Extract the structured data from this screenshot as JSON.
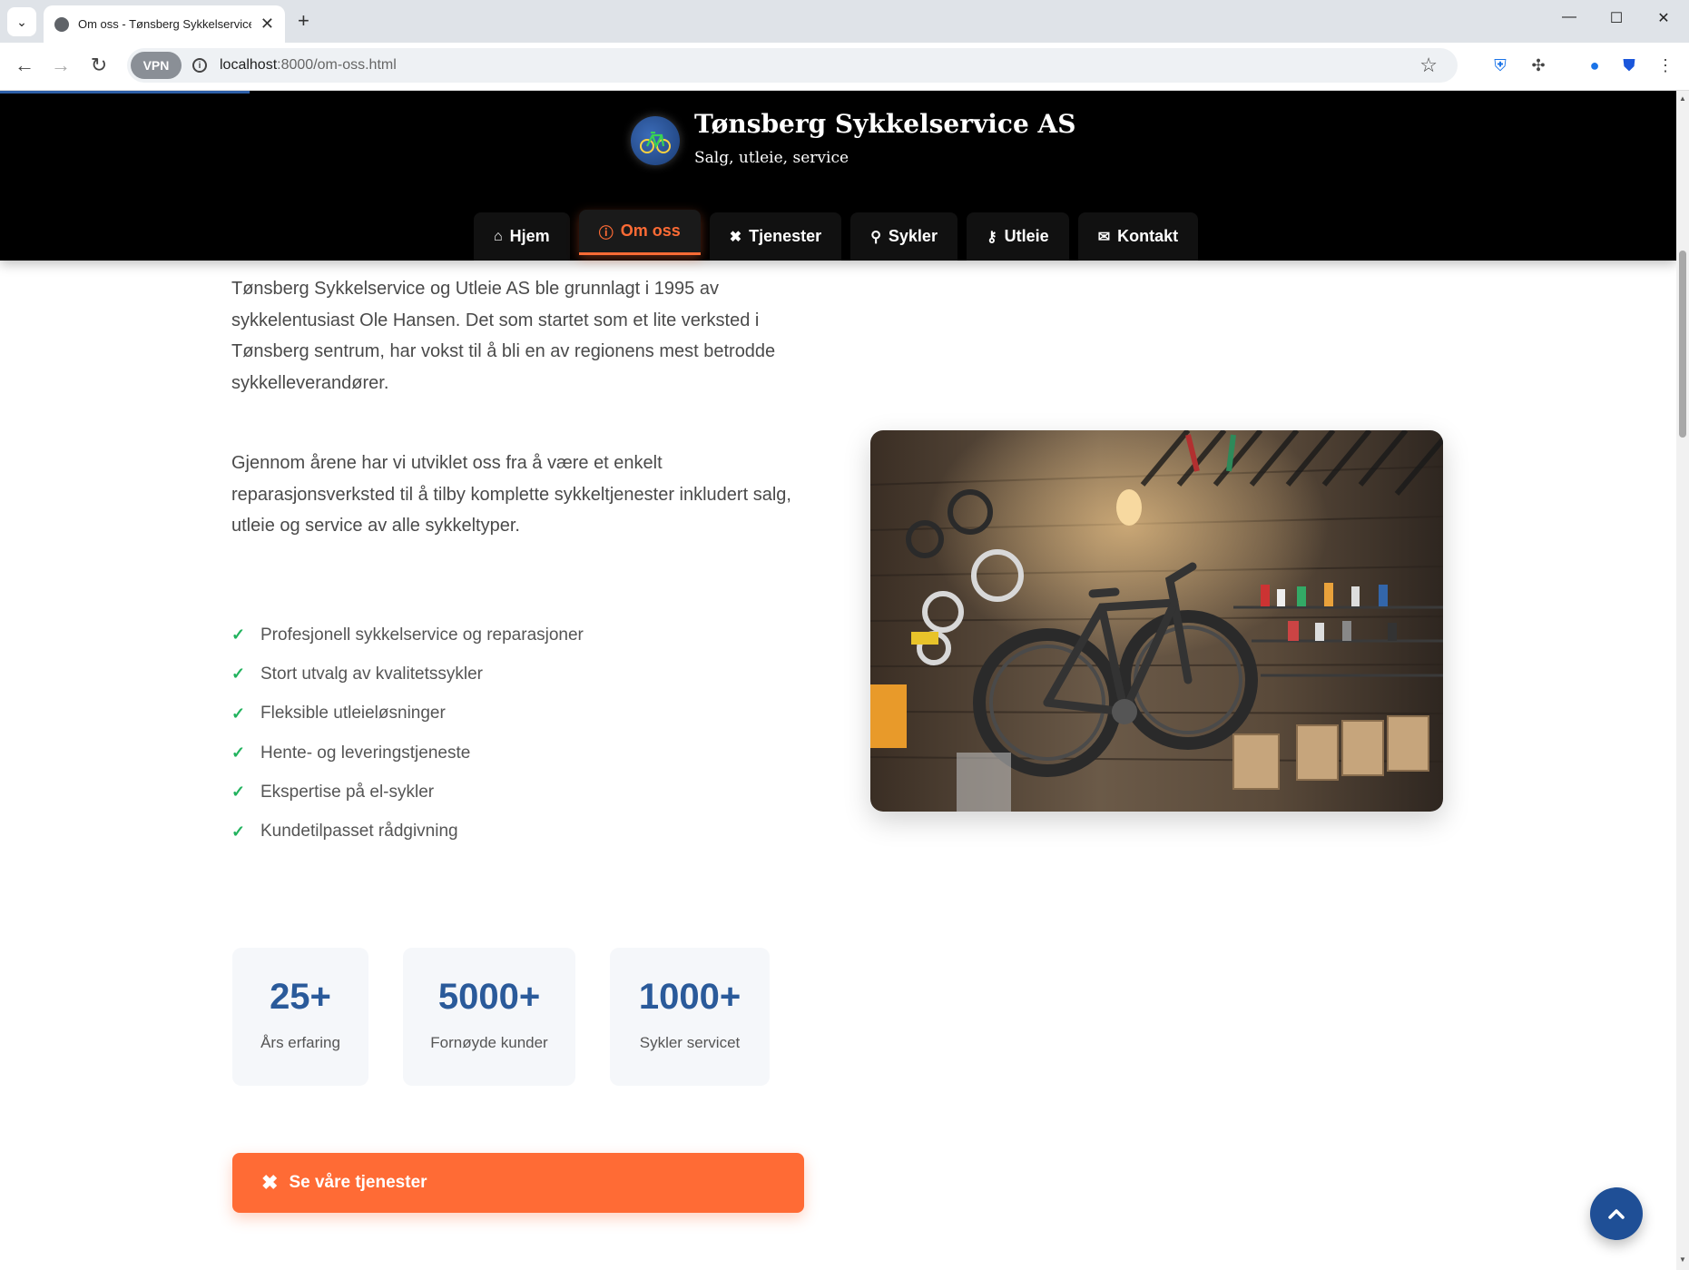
{
  "browser": {
    "tab_title": "Om oss - Tønsberg Sykkelservice o",
    "url_host": "localhost",
    "url_rest": ":8000/om-oss.html",
    "vpn_label": "VPN"
  },
  "header": {
    "title": "Tønsberg Sykkelservice AS",
    "subtitle": "Salg, utleie, service"
  },
  "nav": [
    {
      "label": "Hjem",
      "icon": "home-icon"
    },
    {
      "label": "Om oss",
      "icon": "info-icon",
      "active": true
    },
    {
      "label": "Tjenester",
      "icon": "tools-icon"
    },
    {
      "label": "Sykler",
      "icon": "bicycle-icon"
    },
    {
      "label": "Utleie",
      "icon": "key-icon"
    },
    {
      "label": "Kontakt",
      "icon": "envelope-icon"
    }
  ],
  "content": {
    "paragraph1": "Tønsberg Sykkelservice og Utleie AS ble grunnlagt i 1995 av sykkelentusiast Ole Hansen. Det som startet som et lite verksted i Tønsberg sentrum, har vokst til å bli en av regionens mest betrodde sykkelleverandører.",
    "paragraph2": "Gjennom årene har vi utviklet oss fra å være et enkelt reparasjonsverksted til å tilby komplette sykkeltjenester inkludert salg, utleie og service av alle sykkeltyper.",
    "features": [
      "Profesjonell sykkelservice og reparasjoner",
      "Stort utvalg av kvalitetssykler",
      "Fleksible utleieløsninger",
      "Hente- og leveringstjeneste",
      "Ekspertise på el-sykler",
      "Kundetilpasset rådgivning"
    ]
  },
  "stats": [
    {
      "value": "25+",
      "label": "Års erfaring"
    },
    {
      "value": "5000+",
      "label": "Fornøyde kunder"
    },
    {
      "value": "1000+",
      "label": "Sykler servicet"
    }
  ],
  "cta": {
    "label": "Se våre tjenester"
  },
  "colors": {
    "accent": "#ff6b35",
    "primary": "#2a5a9a",
    "check": "#22b35e"
  }
}
